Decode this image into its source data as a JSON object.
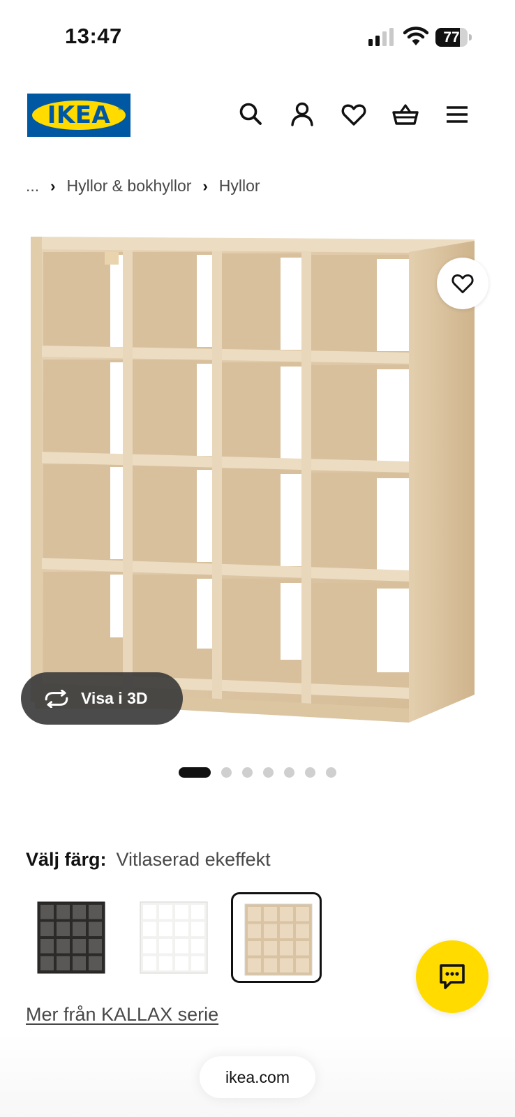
{
  "status_bar": {
    "time": "13:47",
    "battery_level": "77",
    "battery_fraction": 0.77
  },
  "header": {
    "logo_text": "IKEA",
    "icons": [
      "search-icon",
      "account-icon",
      "heart-icon",
      "basket-icon",
      "menu-icon"
    ]
  },
  "breadcrumb": {
    "items": [
      "...",
      "Hyllor & bokhyllor",
      "Hyllor"
    ]
  },
  "product": {
    "view_3d_label": "Visa i 3D",
    "image_count": 7,
    "active_image_index": 0
  },
  "color_selector": {
    "label": "Välj färg:",
    "selected_value": "Vitlaserad ekeffekt",
    "swatches": [
      {
        "color": "#2b2a29"
      },
      {
        "color": "#f2f2f0"
      },
      {
        "color": "#d9c3a3"
      }
    ],
    "selected_index": 2
  },
  "links": {
    "series_link": "Mer från KALLAX serie"
  },
  "browser": {
    "url": "ikea.com"
  },
  "colors": {
    "ikea_blue": "#0058a3",
    "ikea_yellow": "#ffdb00"
  }
}
